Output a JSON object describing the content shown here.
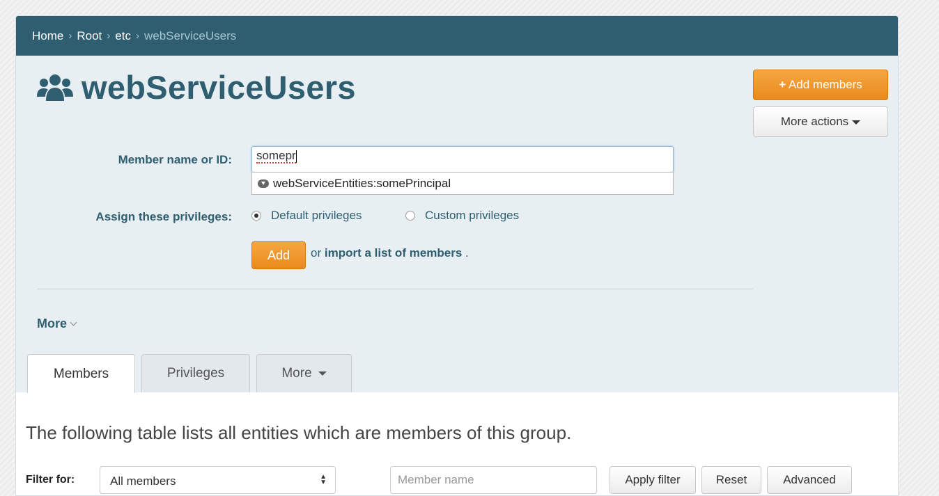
{
  "breadcrumb": [
    {
      "label": "Home",
      "current": false
    },
    {
      "label": "Root",
      "current": false
    },
    {
      "label": "etc",
      "current": false
    },
    {
      "label": "webServiceUsers",
      "current": true
    }
  ],
  "page_title": "webServiceUsers",
  "actions": {
    "add_members": "Add members",
    "more_actions": "More actions"
  },
  "form": {
    "member_label": "Member name or ID:",
    "member_value": "somepr",
    "suggestion": "webServiceEntities:somePrincipal",
    "privileges_label": "Assign these privileges:",
    "radio_default": "Default privileges",
    "radio_custom": "Custom privileges",
    "radio_selected": "Default privileges",
    "add_button": "Add",
    "or_text": "or",
    "import_link": "import a list of members",
    "period": "."
  },
  "more_toggle": "More",
  "tabs": [
    {
      "label": "Members",
      "active": true
    },
    {
      "label": "Privileges",
      "active": false
    },
    {
      "label": "More",
      "active": false
    }
  ],
  "content": {
    "intro": "The following table lists all entities which are members of this group.",
    "filter_label": "Filter for:",
    "filter_select_value": "All members",
    "member_name_placeholder": "Member name",
    "apply_filter": "Apply filter",
    "reset": "Reset",
    "advanced": "Advanced"
  },
  "colors": {
    "header_bar": "#2e5e6f",
    "header_area": "#e8eff3",
    "accent_orange": "#ea8a1c"
  }
}
